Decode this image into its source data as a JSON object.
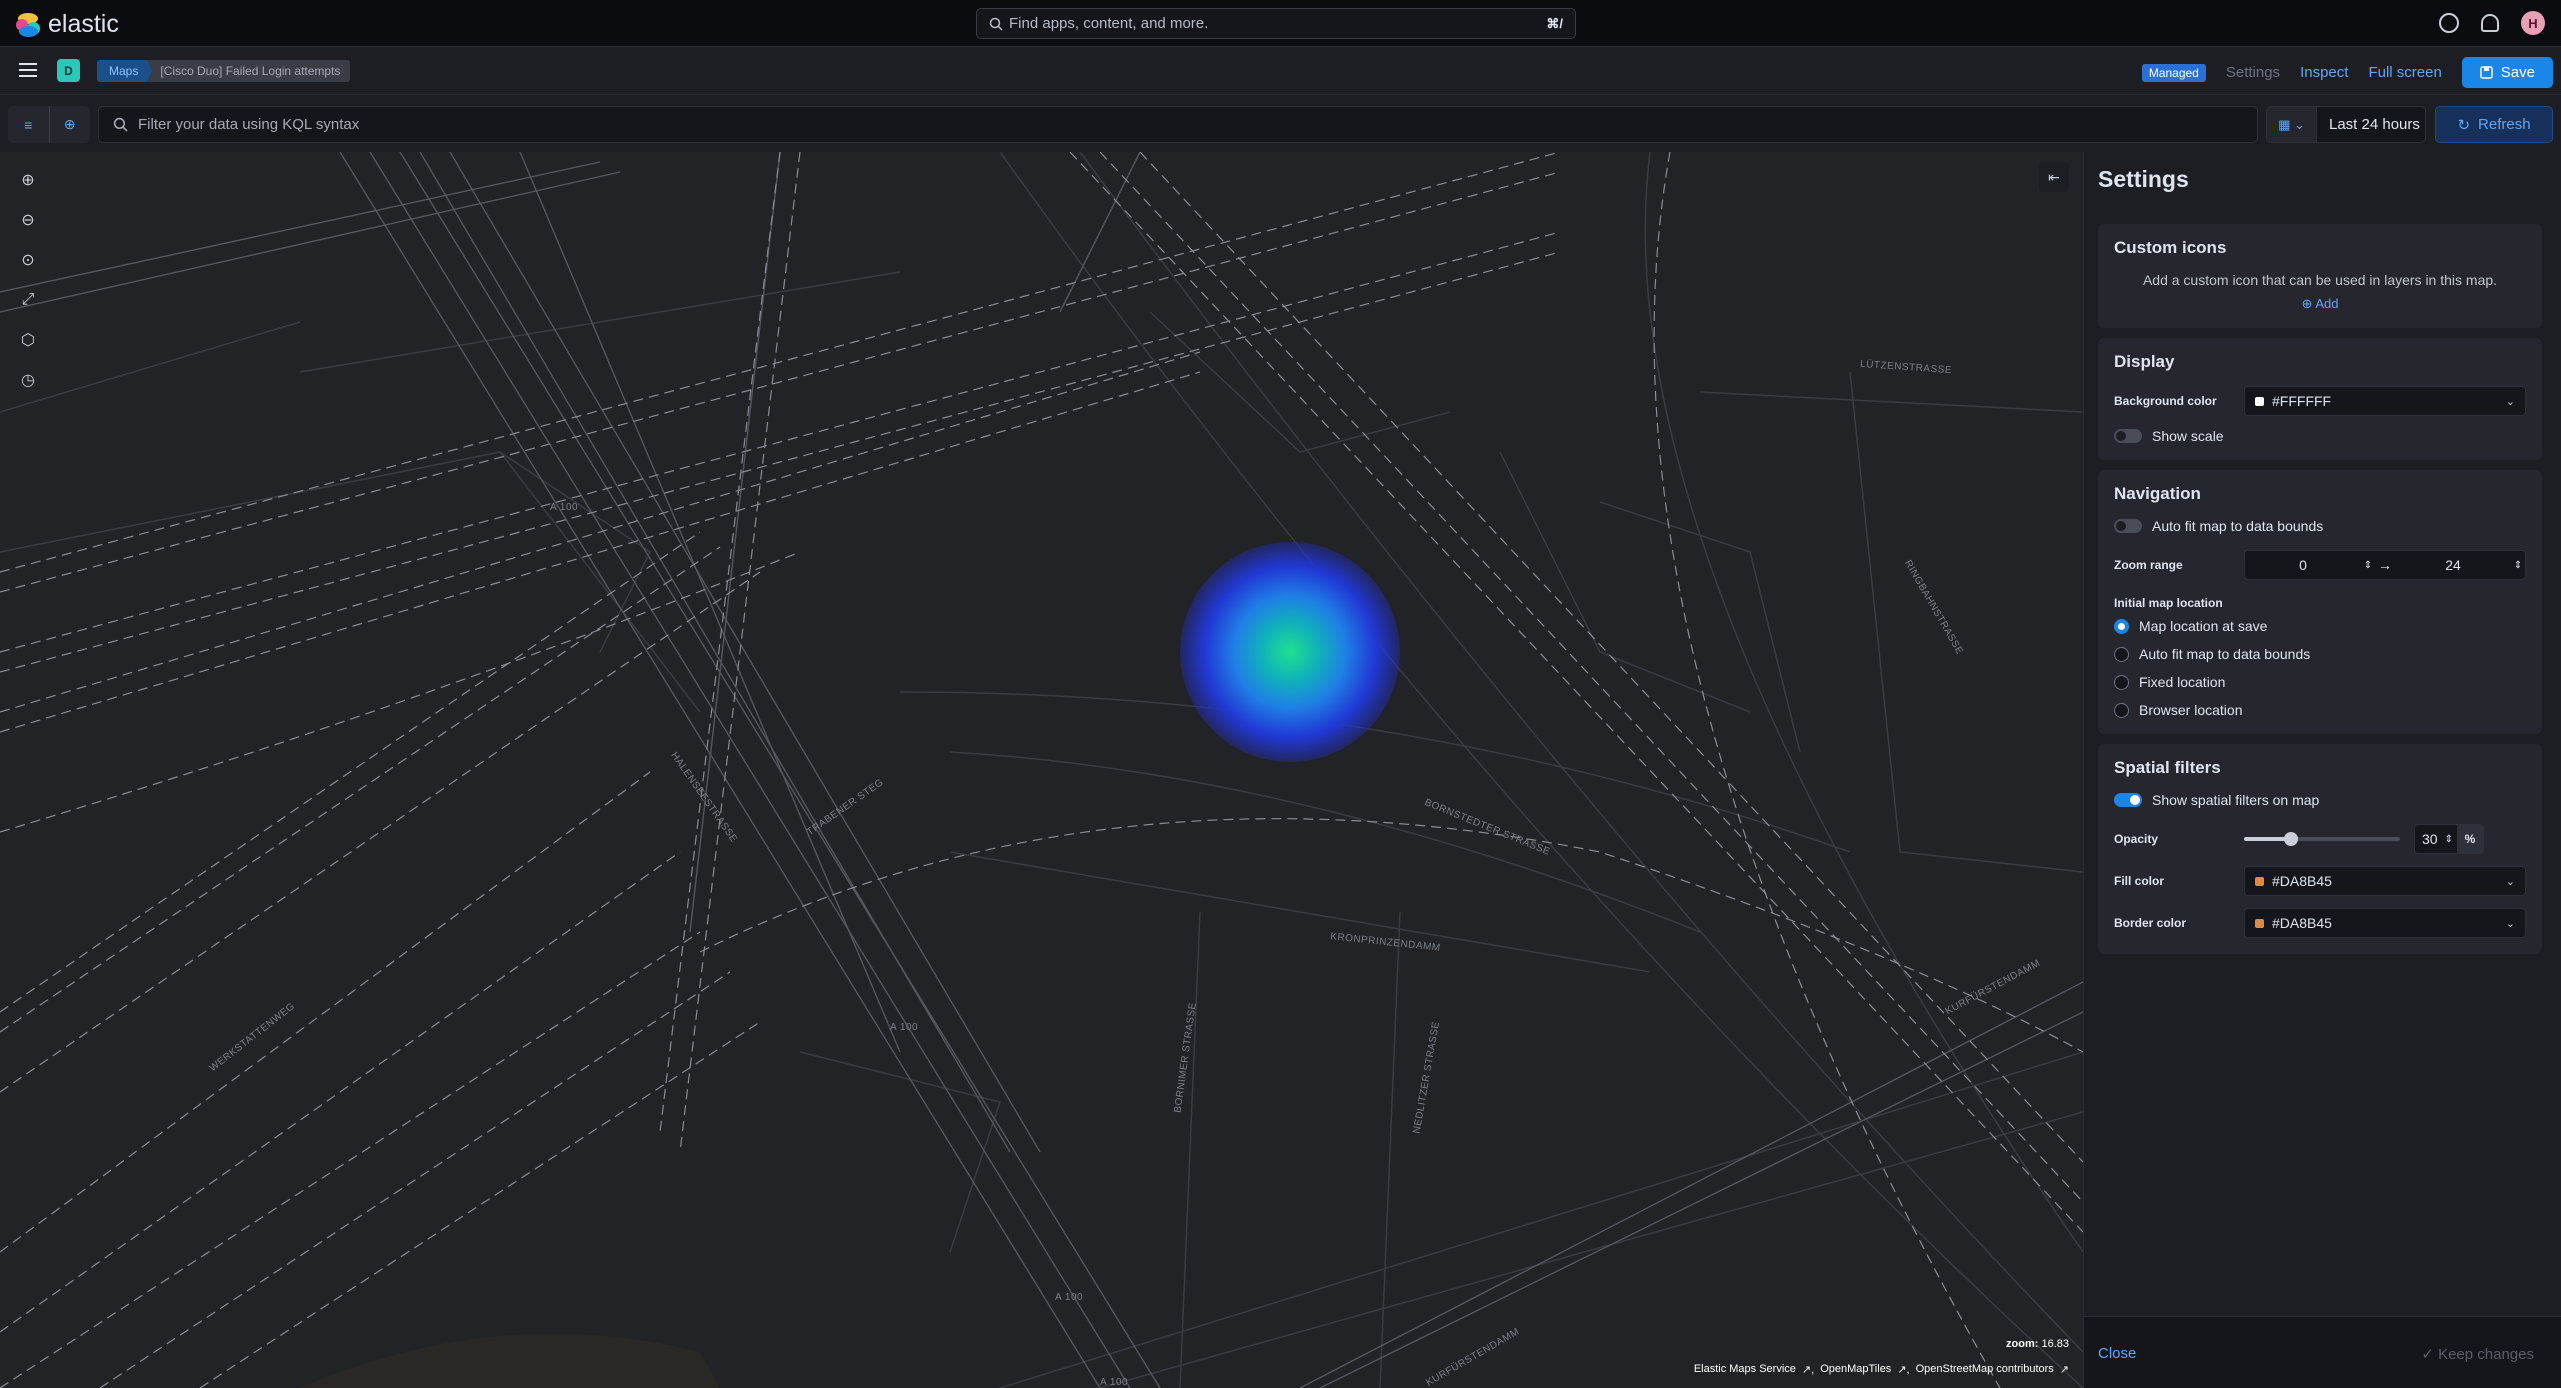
{
  "header": {
    "logo_text": "elastic",
    "search_placeholder": "Find apps, content, and more.",
    "search_shortcut": "⌘/",
    "user_initial": "H"
  },
  "nav": {
    "space_initial": "D",
    "breadcrumbs": [
      "Maps",
      "[Cisco Duo] Failed Login attempts"
    ],
    "managed_badge": "Managed",
    "settings_link": "Settings",
    "inspect_link": "Inspect",
    "fullscreen_link": "Full screen",
    "save_label": "Save"
  },
  "query": {
    "kql_placeholder": "Filter your data using KQL syntax",
    "time_range": "Last 24 hours",
    "refresh_label": "Refresh"
  },
  "map": {
    "zoom_label": "zoom:",
    "zoom_value": "16.83",
    "attributions": [
      "Elastic Maps Service",
      "OpenMapTiles",
      "OpenStreetMap contributors"
    ],
    "streets": [
      "LÜTZENSTRASSE",
      "BORNSTEDTER STRASSE",
      "KRONPRINZENDAMM",
      "KURFÜRSTENDAMM",
      "HALENSEESTRASSE",
      "A 100",
      "A 100",
      "A 100",
      "A 100",
      "WERKSTATTENWEG",
      "BORNIMER STRASSE",
      "NEDLITZER STRASSE",
      "RINGBAHNSTRASSE",
      "TRABENER STEG",
      "KURFÜRSTENDAMM"
    ]
  },
  "settings": {
    "title": "Settings",
    "custom_icons": {
      "heading": "Custom icons",
      "description": "Add a custom icon that can be used in layers in this map.",
      "add_label": "Add"
    },
    "display": {
      "heading": "Display",
      "background_label": "Background color",
      "background_value": "#FFFFFF",
      "background_swatch": "#FFFFFF",
      "show_scale_label": "Show scale",
      "show_scale_on": false
    },
    "navigation": {
      "heading": "Navigation",
      "autofit_label": "Auto fit map to data bounds",
      "autofit_on": false,
      "zoom_range_label": "Zoom range",
      "zoom_min": "0",
      "zoom_max": "24",
      "initial_location_label": "Initial map location",
      "options": [
        "Map location at save",
        "Auto fit map to data bounds",
        "Fixed location",
        "Browser location"
      ],
      "selected_option": 0
    },
    "spatial": {
      "heading": "Spatial filters",
      "show_label": "Show spatial filters on map",
      "show_on": true,
      "opacity_label": "Opacity",
      "opacity_value": "30",
      "opacity_unit": "%",
      "fill_label": "Fill color",
      "fill_value": "#DA8B45",
      "border_label": "Border color",
      "border_value": "#DA8B45",
      "swatch_color": "#DA8B45"
    },
    "footer": {
      "close_label": "Close",
      "keep_label": "Keep changes"
    }
  }
}
